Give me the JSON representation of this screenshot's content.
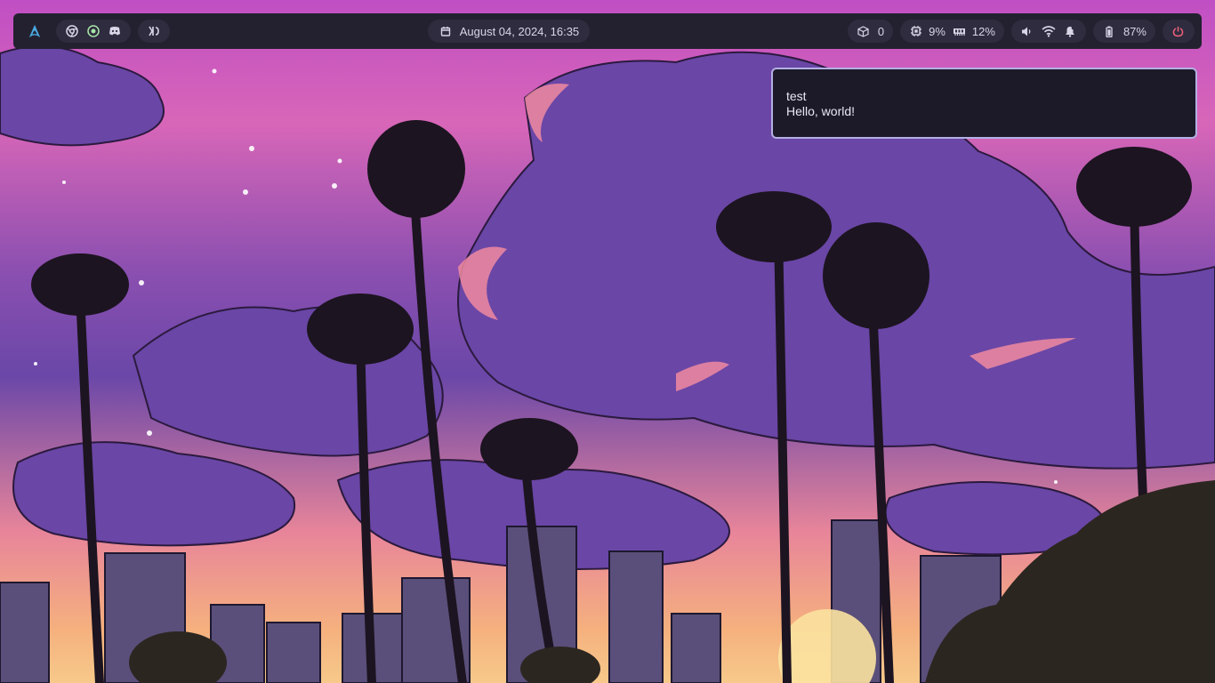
{
  "topbar": {
    "datetime": "August 04, 2024, 16:35",
    "updates_count": "0",
    "cpu": "9%",
    "memory": "12%",
    "battery": "87%",
    "icons": {
      "logo": "arch-logo-icon",
      "browser": "chrome-icon",
      "app2": "circle-dot-icon",
      "chat": "discord-icon",
      "editor": "vscode-icon",
      "calendar": "calendar-icon",
      "updates": "package-icon",
      "cpu": "cpu-icon",
      "memory": "memory-icon",
      "volume": "volume-icon",
      "wifi": "wifi-icon",
      "notifications": "bell-icon",
      "battery": "battery-icon",
      "power": "power-icon"
    },
    "colors": {
      "bar_bg": "#23212f",
      "pill_bg": "#2f2c3f",
      "accent": "#4aa8e0",
      "power": "#f0607a"
    }
  },
  "notification": {
    "title": "test",
    "body": "Hello, world!",
    "border_color": "#b3b0e3"
  }
}
